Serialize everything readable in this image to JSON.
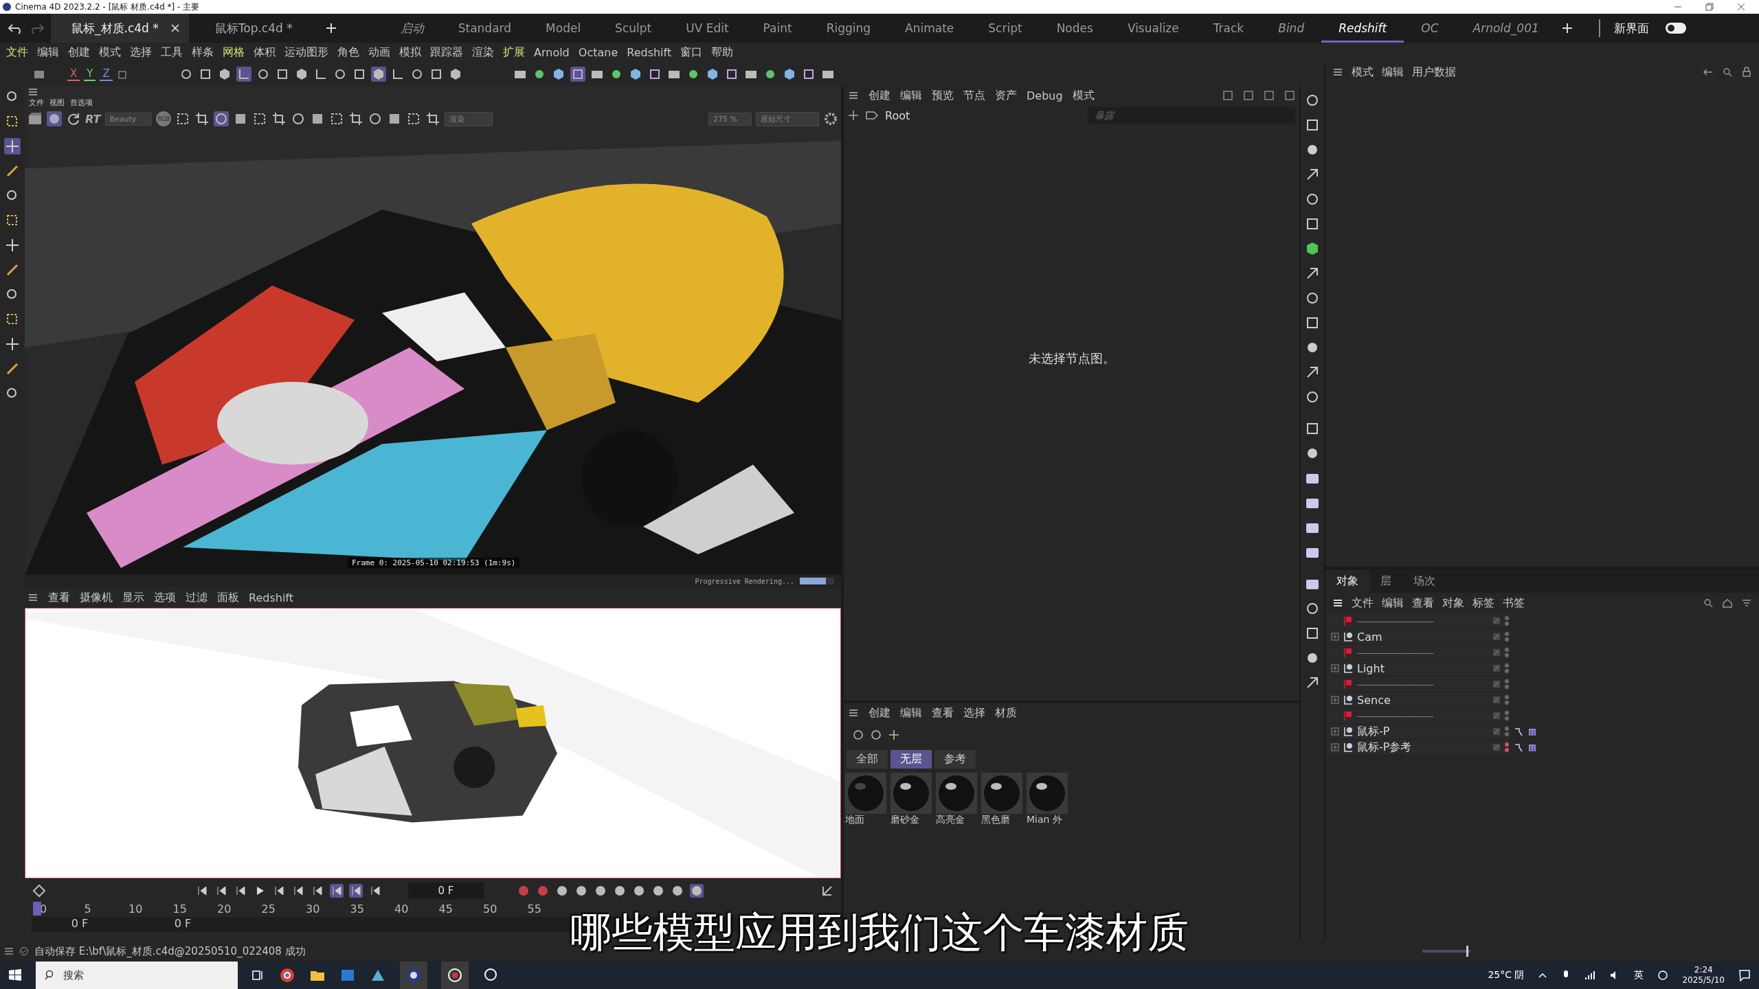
{
  "window": {
    "title": "Cinema 4D 2023.2.2 - [鼠标 材质.c4d *] - 主要"
  },
  "file_tabs": [
    {
      "label": "鼠标_材质.c4d *",
      "selected": true
    },
    {
      "label": "鼠标Top.c4d *",
      "selected": false
    }
  ],
  "layouts": [
    {
      "label": "启动",
      "kind": "custom",
      "selected": false
    },
    {
      "label": "Standard",
      "kind": "builtin",
      "selected": false
    },
    {
      "label": "Model",
      "kind": "builtin",
      "selected": false
    },
    {
      "label": "Sculpt",
      "kind": "builtin",
      "selected": false
    },
    {
      "label": "UV Edit",
      "kind": "builtin",
      "selected": false
    },
    {
      "label": "Paint",
      "kind": "builtin",
      "selected": false
    },
    {
      "label": "Rigging",
      "kind": "builtin",
      "selected": false
    },
    {
      "label": "Animate",
      "kind": "builtin",
      "selected": false
    },
    {
      "label": "Script",
      "kind": "builtin",
      "selected": false
    },
    {
      "label": "Nodes",
      "kind": "builtin",
      "selected": false
    },
    {
      "label": "Visualize",
      "kind": "builtin",
      "selected": false
    },
    {
      "label": "Track",
      "kind": "builtin",
      "selected": false
    },
    {
      "label": "Bind",
      "kind": "custom",
      "selected": false
    },
    {
      "label": "Redshift",
      "kind": "custom",
      "selected": true
    },
    {
      "label": "OC",
      "kind": "custom",
      "selected": false
    },
    {
      "label": "Arnold_001",
      "kind": "custom",
      "selected": false
    }
  ],
  "new_ui": {
    "label": "新界面",
    "on": false
  },
  "menu": [
    {
      "label": "文件",
      "highlighted": true
    },
    {
      "label": "编辑",
      "highlighted": false
    },
    {
      "label": "创建",
      "highlighted": false
    },
    {
      "label": "模式",
      "highlighted": false
    },
    {
      "label": "选择",
      "highlighted": false
    },
    {
      "label": "工具",
      "highlighted": false
    },
    {
      "label": "样条",
      "highlighted": false
    },
    {
      "label": "网格",
      "highlighted": true
    },
    {
      "label": "体积",
      "highlighted": false
    },
    {
      "label": "运动图形",
      "highlighted": false
    },
    {
      "label": "角色",
      "highlighted": false
    },
    {
      "label": "动画",
      "highlighted": false
    },
    {
      "label": "模拟",
      "highlighted": false
    },
    {
      "label": "跟踪器",
      "highlighted": false
    },
    {
      "label": "渲染",
      "highlighted": false
    },
    {
      "label": "扩展",
      "highlighted": true
    },
    {
      "label": "Arnold",
      "highlighted": false
    },
    {
      "label": "Octane",
      "highlighted": false
    },
    {
      "label": "Redshift",
      "highlighted": false
    },
    {
      "label": "窗口",
      "highlighted": false
    },
    {
      "label": "帮助",
      "highlighted": false
    }
  ],
  "axis_buttons": [
    "X",
    "Y",
    "Z"
  ],
  "render_view": {
    "menu": [
      "文件",
      "视图",
      "首选项"
    ],
    "rt_label": "RT",
    "aov_dropdown": "Beauty",
    "rgb_badge": "RGB",
    "render_dropdown": "渲染",
    "zoom": "275 %",
    "size_dropdown": "原始尺寸",
    "stamp": "Frame 0:  2025-05-10  02:19:53  (1m:9s)",
    "progress_label": "Progressive Rendering...",
    "progress": {
      "level": 0.75
    }
  },
  "viewport": {
    "menu": [
      "查看",
      "摄像机",
      "显示",
      "选项",
      "过滤",
      "面板",
      "Redshift"
    ]
  },
  "timeline": {
    "frame": "0 F",
    "ticks": [
      "0",
      "5",
      "10",
      "15",
      "20",
      "25",
      "30",
      "35",
      "40",
      "45",
      "50",
      "55"
    ],
    "start": "0 F",
    "end": "0 F"
  },
  "node_editor": {
    "menu": [
      "创建",
      "编辑",
      "预览",
      "节点",
      "资产",
      "Debug",
      "模式"
    ],
    "root": "Root",
    "search_placeholder": "暴露",
    "empty_message": "未选择节点图。"
  },
  "attributes": {
    "menu": [
      "模式",
      "编辑",
      "用户数据"
    ]
  },
  "object_manager": {
    "tabs": [
      {
        "label": "对象",
        "selected": true
      },
      {
        "label": "层",
        "selected": false
      },
      {
        "label": "场次",
        "selected": false
      }
    ],
    "menu": [
      "文件",
      "编辑",
      "查看",
      "对象",
      "标签",
      "书签"
    ],
    "rows": [
      {
        "kind": "separator",
        "name": "----------------------------",
        "color": "#6a6a6a",
        "tags": false
      },
      {
        "kind": "null",
        "name": "Cam",
        "color": "#6a6a6a",
        "tags": false
      },
      {
        "kind": "separator",
        "name": "----------------------------",
        "color": "#6a6a6a",
        "tags": false
      },
      {
        "kind": "null",
        "name": "Light",
        "color": "#6a6a6a",
        "tags": false
      },
      {
        "kind": "separator",
        "name": "----------------------------",
        "color": "#6a6a6a",
        "tags": false
      },
      {
        "kind": "null",
        "name": "Sence",
        "color": "#6a6a6a",
        "tags": false
      },
      {
        "kind": "separator",
        "name": "----------------------------",
        "color": "#6a6a6a",
        "tags": false
      },
      {
        "kind": "null",
        "name": "鼠标-P",
        "color": "#6a6a6a",
        "tags": true
      },
      {
        "kind": "null",
        "name": "鼠标-P参考",
        "color": "#d0506a",
        "tags": true
      }
    ]
  },
  "material_manager": {
    "menu": [
      "创建",
      "编辑",
      "查看",
      "选择",
      "材质"
    ],
    "filters": [
      {
        "label": "全部",
        "selected": false
      },
      {
        "label": "无层",
        "selected": true
      },
      {
        "label": "参考",
        "selected": false
      }
    ],
    "materials": [
      "地面",
      "磨砂金",
      "高亮金",
      "黑色磨",
      "Mian 外"
    ]
  },
  "status": "自动保存 E:\\bf\\鼠标_材质.c4d@20250510_022408 成功",
  "zoom_slider": {
    "level": 0.95
  },
  "subtitle": "哪些模型应用到我们这个车漆材质",
  "taskbar": {
    "search_placeholder": "搜索",
    "weather": "25°C 阴",
    "ime": "英",
    "time": "2:24",
    "date": "2025/5/10"
  }
}
